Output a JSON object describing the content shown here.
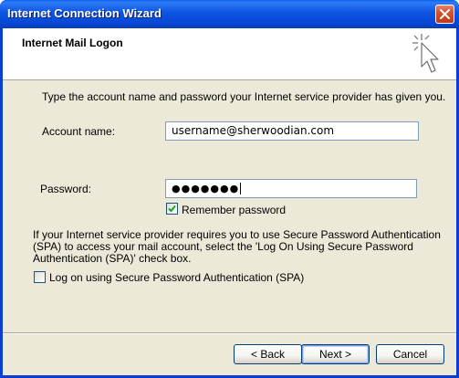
{
  "window": {
    "title": "Internet Connection Wizard",
    "close_icon": "close-x-icon"
  },
  "header": {
    "title": "Internet Mail Logon",
    "icon": "wizard-sparkle-cursor-icon"
  },
  "instruction": "Type the account name and password your Internet service provider has given you.",
  "account": {
    "label": "Account name:",
    "value": "username@sherwoodian.com"
  },
  "password": {
    "label": "Password:",
    "masked_value": "●●●●●●●"
  },
  "remember_password": {
    "label": "Remember password",
    "checked": true
  },
  "spa": {
    "info_lines": [
      "If your Internet service provider requires you to use Secure Password Authentication",
      "(SPA) to access your mail account, select the 'Log On Using Secure Password",
      "Authentication (SPA)' check box."
    ],
    "checkbox_label": "Log on using Secure Password Authentication (SPA)",
    "checked": false
  },
  "buttons": {
    "back": "< Back",
    "next": "Next >",
    "cancel": "Cancel"
  },
  "colors": {
    "titlebar": "#0a54e3",
    "dialog_face": "#ece9d8",
    "input_border": "#7f9db9",
    "checkmark": "#21a121"
  }
}
